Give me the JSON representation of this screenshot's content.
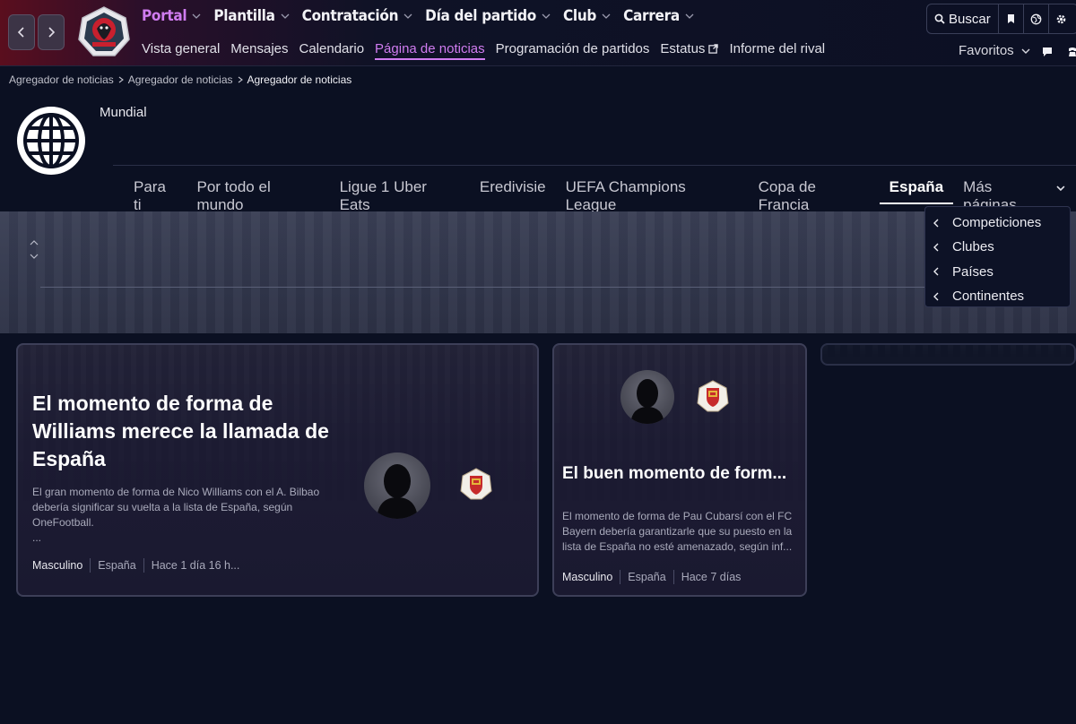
{
  "nav": {
    "back_icon": "chevron-left-icon",
    "forward_icon": "chevron-right-icon",
    "main": [
      {
        "label": "Portal",
        "active": true
      },
      {
        "label": "Plantilla",
        "active": false
      },
      {
        "label": "Contratación",
        "active": false
      },
      {
        "label": "Día del partido",
        "active": false
      },
      {
        "label": "Club",
        "active": false
      },
      {
        "label": "Carrera",
        "active": false
      }
    ],
    "sub": [
      {
        "label": "Vista general"
      },
      {
        "label": "Mensajes"
      },
      {
        "label": "Calendario"
      },
      {
        "label": "Página de noticias",
        "active": true
      },
      {
        "label": "Programación de partidos"
      },
      {
        "label": "Estatus",
        "external": true
      },
      {
        "label": "Informe del rival"
      }
    ],
    "search_label": "Buscar",
    "favorites_label": "Favoritos"
  },
  "breadcrumb": [
    "Agregador de noticias",
    "Agregador de noticias",
    "Agregador de noticias"
  ],
  "page": {
    "title": "Mundial"
  },
  "tabs": [
    {
      "label": "Para ti"
    },
    {
      "label": "Por todo el mundo"
    },
    {
      "label": "Ligue 1 Uber Eats"
    },
    {
      "label": "Eredivisie"
    },
    {
      "label": "UEFA Champions League"
    },
    {
      "label": "Copa de Francia"
    },
    {
      "label": "España",
      "active": true
    },
    {
      "label": "Más páginas",
      "dropdown": true
    }
  ],
  "dropdown": {
    "items": [
      "Competiciones",
      "Clubes",
      "Países",
      "Continentes"
    ]
  },
  "articles": [
    {
      "title": "El momento de forma de Williams merece la llamada de España",
      "description": "El gran momento de forma de Nico Williams con el A. Bilbao debería significar su vuelta a la lista de España, según OneFootball.",
      "ellipsis": "...",
      "meta": [
        "Masculino",
        "España",
        "Hace 1 día 16 h..."
      ]
    },
    {
      "title": "El buen momento de form...",
      "description": "El momento de forma de Pau Cubarsí con el FC Bayern debería garantizarle que su puesto en la lista de España no esté amenazado, según inf...",
      "meta": [
        "Masculino",
        "España",
        "Hace 7 días"
      ]
    }
  ],
  "colors": {
    "accent": "#d07cf0",
    "background": "#0b1022",
    "card_border": "#3d3f58"
  }
}
